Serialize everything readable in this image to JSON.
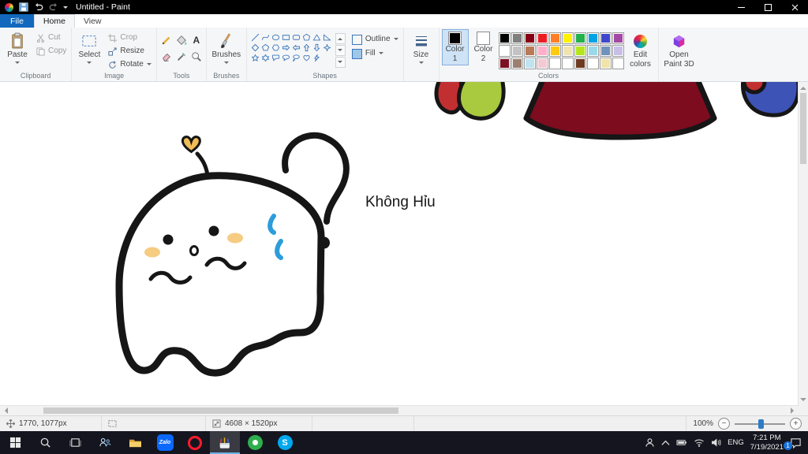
{
  "window": {
    "title": "Untitled - Paint"
  },
  "tabs": {
    "file": "File",
    "home": "Home",
    "view": "View"
  },
  "ribbon": {
    "clipboard": {
      "label": "Clipboard",
      "paste": "Paste",
      "cut": "Cut",
      "copy": "Copy"
    },
    "image": {
      "label": "Image",
      "select": "Select",
      "crop": "Crop",
      "resize": "Resize",
      "rotate": "Rotate"
    },
    "tools": {
      "label": "Tools",
      "text_tool": "A"
    },
    "brushes": {
      "label": "Brushes"
    },
    "shapes": {
      "label": "Shapes",
      "outline": "Outline",
      "fill": "Fill",
      "icons": [
        "line",
        "curve",
        "oval",
        "rectangle",
        "rounded-rectangle",
        "polygon",
        "triangle",
        "right-triangle",
        "diamond",
        "pentagon",
        "hexagon",
        "right-arrow",
        "left-arrow",
        "up-arrow",
        "down-arrow",
        "four-point-star",
        "five-point-star",
        "six-point-star",
        "rounded-callout",
        "oval-callout",
        "cloud-callout",
        "heart",
        "lightning"
      ]
    },
    "size": {
      "label": "Size"
    },
    "colors": {
      "label": "Colors",
      "color1_label": "Color\n1",
      "color2_label": "Color\n2",
      "color1": "#000000",
      "color2": "#ffffff",
      "edit_colors_label": "Edit\ncolors",
      "open_paint3d_label": "Open\nPaint 3D",
      "palette": [
        "#000000",
        "#7f7f7f",
        "#880015",
        "#ed1c24",
        "#ff7f27",
        "#fff200",
        "#22b14c",
        "#00a2e8",
        "#3f48cc",
        "#a349a4",
        "#ffffff",
        "#c3c3c3",
        "#b97a57",
        "#ffaec9",
        "#ffc90e",
        "#efe4b0",
        "#b5e61d",
        "#99d9ea",
        "#7092be",
        "#c8bfe7",
        "#7c1023",
        "#9b8071",
        "#bfe3f0",
        "#f3c9d3",
        "#ffffff",
        "#ffffff",
        "#6f3a22",
        "#ffffff",
        "#f2e3a9",
        "#ffffff"
      ]
    }
  },
  "canvas": {
    "caption": "Không Hỉu",
    "colors": {
      "ink": "#161616",
      "heart": "#f0bc58",
      "blush": "#f6cc82",
      "sweat": "#2d9cdb",
      "hat": "#7d0c1f",
      "green": "#a9c93f",
      "red": "#c22f30",
      "blue": "#3d53b5"
    }
  },
  "statusbar": {
    "cursor_pos": "1770, 1077px",
    "selection_size": "",
    "canvas_size": "4608 × 1520px",
    "zoom": "100%"
  },
  "taskbar": {
    "zalo": "Zalo",
    "skype": "S",
    "tray": {
      "lang": "ENG",
      "time": "7:21 PM",
      "date": "7/19/2021",
      "badge": "1"
    }
  }
}
